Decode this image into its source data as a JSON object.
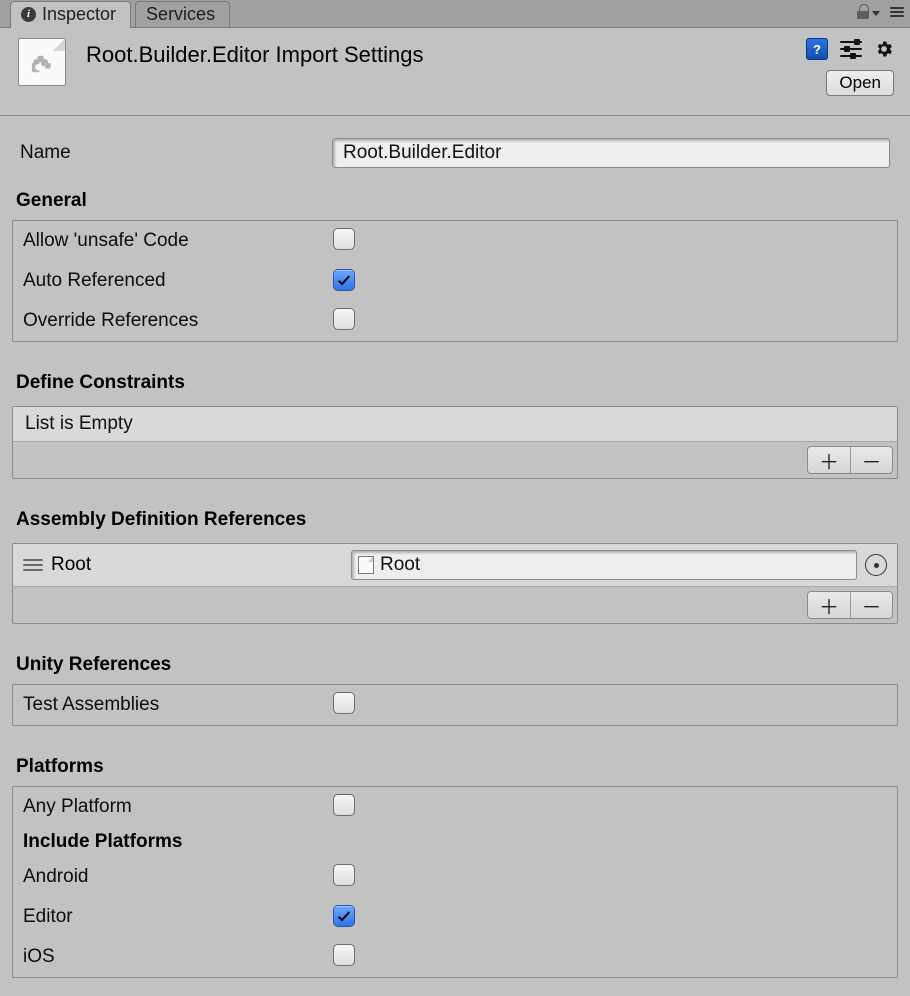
{
  "tabs": {
    "inspector": "Inspector",
    "services": "Services"
  },
  "header": {
    "title": "Root.Builder.Editor Import Settings",
    "open_label": "Open"
  },
  "fields": {
    "name_label": "Name",
    "name_value": "Root.Builder.Editor"
  },
  "sections": {
    "general": "General",
    "define_constraints": "Define Constraints",
    "assembly_refs": "Assembly Definition References",
    "unity_refs": "Unity References",
    "platforms": "Platforms",
    "include_platforms": "Include Platforms"
  },
  "general": {
    "allow_unsafe_label": "Allow 'unsafe' Code",
    "allow_unsafe_checked": false,
    "auto_referenced_label": "Auto Referenced",
    "auto_referenced_checked": true,
    "override_refs_label": "Override References",
    "override_refs_checked": false
  },
  "define_constraints": {
    "empty_text": "List is Empty"
  },
  "assembly_refs": {
    "items": [
      {
        "label": "Root",
        "value": "Root"
      }
    ]
  },
  "unity_refs": {
    "test_assemblies_label": "Test Assemblies",
    "test_assemblies_checked": false
  },
  "platforms": {
    "any_platform_label": "Any Platform",
    "any_platform_checked": false,
    "items": [
      {
        "label": "Android",
        "checked": false
      },
      {
        "label": "Editor",
        "checked": true
      },
      {
        "label": "iOS",
        "checked": false
      }
    ]
  },
  "icons": {
    "plus": "＋",
    "minus": "－"
  }
}
